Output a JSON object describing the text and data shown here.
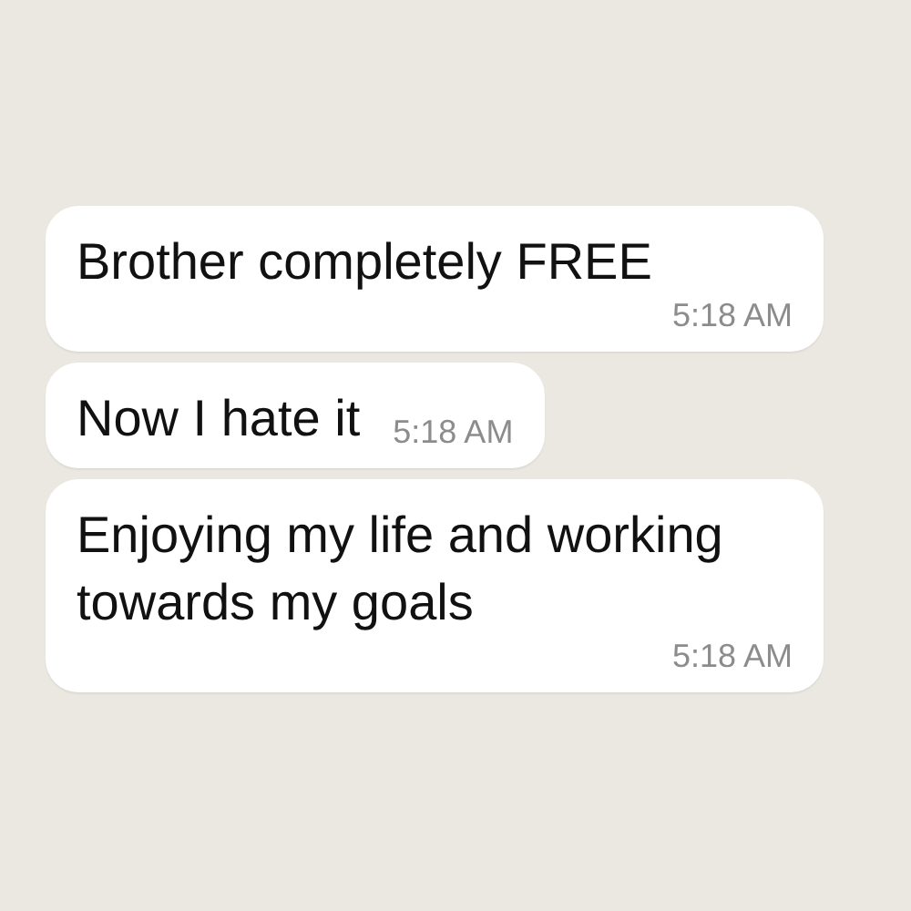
{
  "messages": [
    {
      "text": "Brother completely FREE",
      "time": "5:18 AM"
    },
    {
      "text": "Now I hate it",
      "time": "5:18 AM"
    },
    {
      "text": "Enjoying my life and working towards my goals",
      "time": "5:18 AM"
    }
  ]
}
